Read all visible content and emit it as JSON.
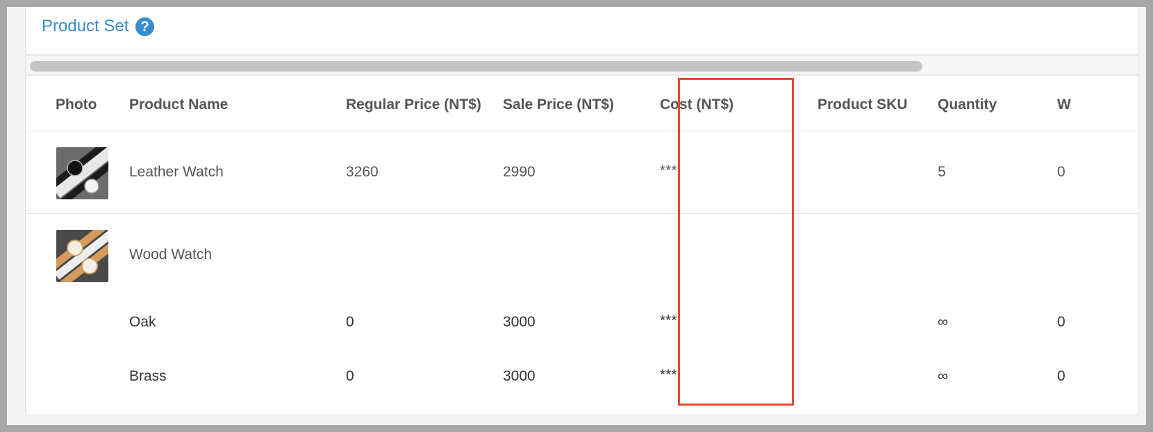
{
  "section": {
    "title": "Product Set",
    "help_icon": "question-circle-icon",
    "help_glyph": "?"
  },
  "table": {
    "columns": [
      "Photo",
      "Product Name",
      "Regular Price (NT$)",
      "Sale Price (NT$)",
      "Cost (NT$)",
      "Product SKU",
      "Quantity",
      "W"
    ],
    "rows": [
      {
        "photo": "leather-watch-thumbnail",
        "name": "Leather Watch",
        "regular_price": "3260",
        "sale_price": "2990",
        "cost": "***",
        "sku": "",
        "quantity": "5",
        "w": "0"
      },
      {
        "photo": "wood-watch-thumbnail",
        "name": "Wood Watch",
        "variants": [
          {
            "name": "Oak",
            "regular_price": "0",
            "sale_price": "3000",
            "cost": "***",
            "sku": "",
            "quantity": "∞",
            "w": "0"
          },
          {
            "name": "Brass",
            "regular_price": "0",
            "sale_price": "3000",
            "cost": "***",
            "sku": "",
            "quantity": "∞",
            "w": "0"
          }
        ]
      }
    ]
  },
  "colors": {
    "accent": "#3a8ad0",
    "highlight_border": "#e24a33",
    "text": "#555555",
    "divider": "#e3e3e3"
  }
}
